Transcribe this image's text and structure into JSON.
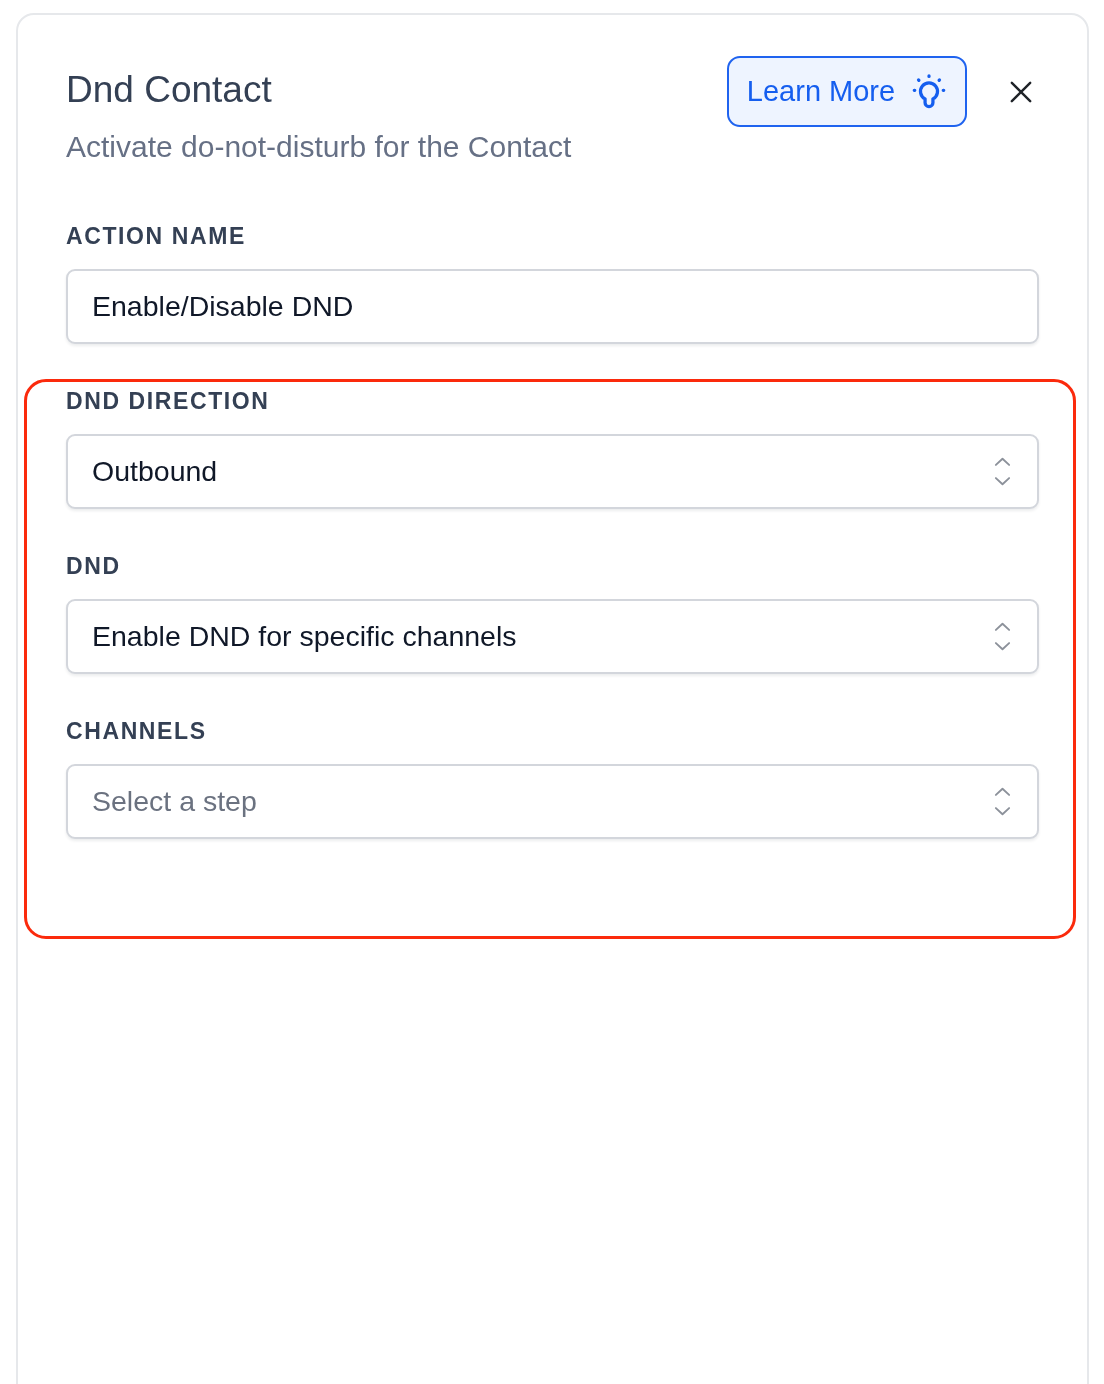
{
  "panel": {
    "title": "Dnd Contact",
    "subtitle": "Activate do-not-disturb for the Contact",
    "learn_more_button": {
      "label": "Learn More"
    }
  },
  "sections": [
    {
      "highlighted": false,
      "fields": [
        {
          "kind": "text",
          "label": "ACTION NAME",
          "value": "Enable/Disable DND"
        }
      ]
    },
    {
      "highlighted": true,
      "fields": [
        {
          "kind": "select",
          "label": "DND DIRECTION",
          "value": "Outbound"
        },
        {
          "kind": "select",
          "label": "DND",
          "value": "Enable DND for specific channels"
        },
        {
          "kind": "select",
          "label": "CHANNELS",
          "placeholder": "Select a step"
        }
      ]
    }
  ]
}
